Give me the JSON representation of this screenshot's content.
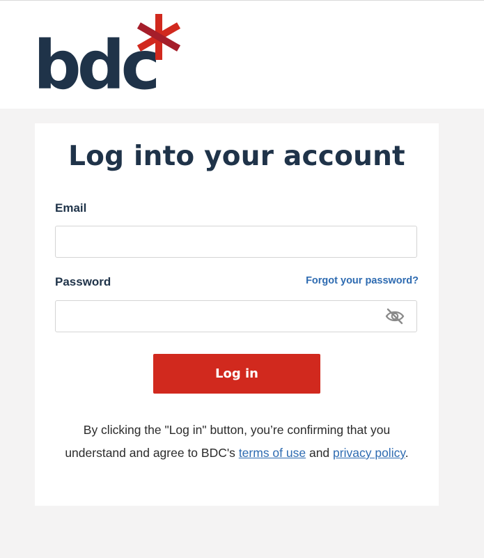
{
  "brand": {
    "logo_text": "bdc",
    "colors": {
      "navy": "#1f3349",
      "red": "#d1291e",
      "dark_red": "#a51e2a",
      "link": "#2e6bb1"
    }
  },
  "login_form": {
    "title": "Log into your account",
    "email_label": "Email",
    "email_value": "",
    "password_label": "Password",
    "password_value": "",
    "forgot_link": "Forgot your password?",
    "toggle_icon": "eye-slash-icon",
    "login_button": "Log in"
  },
  "terms": {
    "prefix": "By clicking the \"Log in\" button, you’re confirming that you understand and agree to BDC's ",
    "terms_link": "terms of use",
    "middle": " and ",
    "privacy_link": "privacy policy",
    "suffix": "."
  }
}
